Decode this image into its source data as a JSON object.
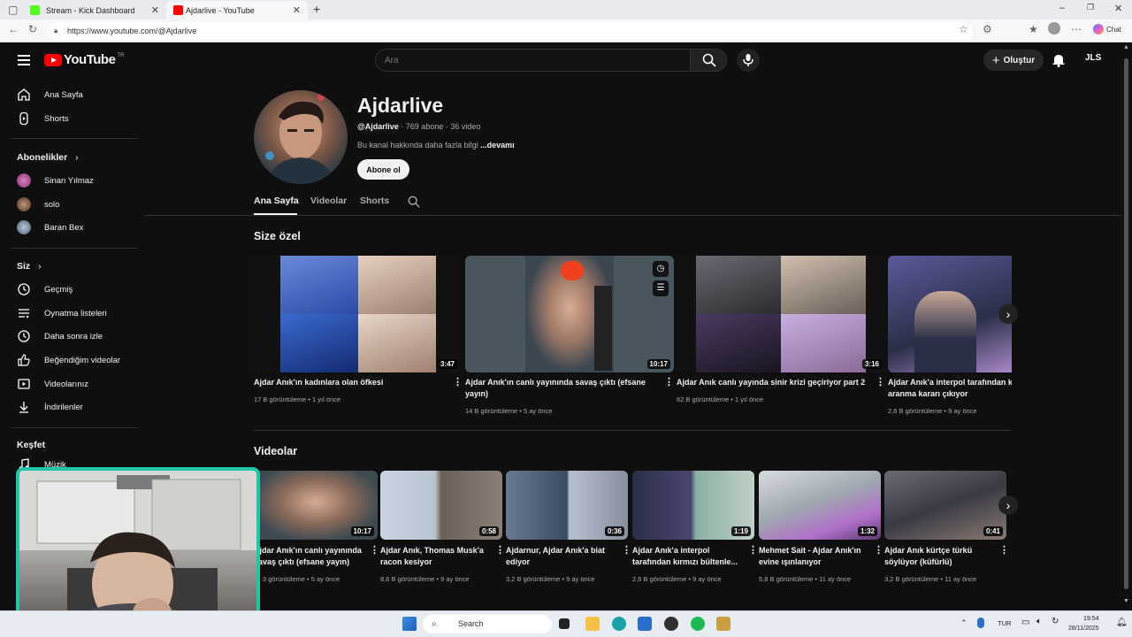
{
  "browser": {
    "tabs": [
      {
        "title": "Stream - Kick Dashboard",
        "favicon_color": "#53fc18"
      },
      {
        "title": "Ajdarlive - YouTube",
        "favicon_color": "#ff0000"
      }
    ],
    "url": "https://www.youtube.com/@Ajdarlive",
    "copilot_label": "Chat"
  },
  "masthead": {
    "logo_text": "YouTube",
    "logo_suffix": "TR",
    "search_placeholder": "Ara",
    "create_label": "Oluştur",
    "account_initials": "JLS"
  },
  "sidebar": {
    "main": [
      {
        "label": "Ana Sayfa",
        "icon": "home-icon"
      },
      {
        "label": "Shorts",
        "icon": "shorts-icon"
      }
    ],
    "subscriptions_title": "Abonelikler",
    "subscriptions": [
      {
        "label": "Sinan Yılmaz",
        "color": "#b84c9a"
      },
      {
        "label": "solo",
        "color": "#7a5a3a"
      },
      {
        "label": "Baran Bex",
        "color": "#5a6e84"
      }
    ],
    "you_title": "Siz",
    "you_items": [
      {
        "label": "Geçmiş",
        "icon": "history-icon"
      },
      {
        "label": "Oynatma listeleri",
        "icon": "playlist-icon"
      },
      {
        "label": "Daha sonra izle",
        "icon": "clock-icon"
      },
      {
        "label": "Beğendiğim videolar",
        "icon": "thumbs-up-icon"
      },
      {
        "label": "Videolarınız",
        "icon": "your-videos-icon"
      },
      {
        "label": "İndirilenler",
        "icon": "download-icon"
      }
    ],
    "explore_title": "Keşfet",
    "explore_items": [
      {
        "label": "Müzik",
        "icon": "music-icon"
      }
    ]
  },
  "channel": {
    "name": "Ajdarlive",
    "handle": "@Ajdarlive",
    "stats": " · 769 abone · 36 video",
    "description": "Bu kanal hakkında daha fazla bilgi",
    "more_label": "...devamı",
    "subscribe_label": "Abone ol",
    "tabs": [
      "Ana Sayfa",
      "Videolar",
      "Shorts"
    ]
  },
  "for_you": {
    "title": "Size özel",
    "videos": [
      {
        "title_line1": "Ajdar Anık'ın kadınlara olan öfkesi",
        "title_line2": "",
        "meta": "17 B görüntüleme • 1 yıl önce",
        "duration": "3:47",
        "colors": [
          "#3a5fb0",
          "#c9a38c",
          "#1d3d8a",
          "#d4b0a0"
        ]
      },
      {
        "title_line1": "Ajdar Anık'ın canlı yayınında savaş çıktı (efsane",
        "title_line2": "yayın)",
        "meta": "14 B görüntüleme • 5 ay önce",
        "duration": "10:17",
        "colors": [
          "#3d4a52",
          "#caa08a",
          "#44505a",
          "#5a6570"
        ]
      },
      {
        "title_line1": "Ajdar Anık canlı yayında sinir krizi geçiriyor part 2",
        "title_line2": "",
        "meta": "62 B görüntüleme • 1 yıl önce",
        "duration": "3:16",
        "colors": [
          "#55555c",
          "#b09a8e",
          "#6a5878",
          "#c4a898"
        ]
      },
      {
        "title_line1": "Ajdar Anık'a interpol tarafından kı",
        "title_line2": "aranma kararı çıkıyor",
        "meta": "2,6 B görüntüleme • 9 ay önce",
        "duration": "",
        "colors": [
          "#2a2f48",
          "#6a6aa8",
          "#3a3560",
          "#a88ec0"
        ]
      }
    ]
  },
  "videos_section": {
    "title": "Videolar",
    "videos": [
      {
        "title_line1": "Ajdar Anık'ın canlı yayınında",
        "title_line2": "savaş çıktı (efsane yayın)",
        "meta": "3 görüntüleme • 5 ay önce",
        "duration": "10:17",
        "colors": [
          "#3d4a52",
          "#caa08a"
        ]
      },
      {
        "title_line1": "Ajdar Anık, Thomas Musk'a",
        "title_line2": "racon kesiyor",
        "meta": "8,6 B görüntüleme • 9 ay önce",
        "duration": "0:58",
        "colors": [
          "#b8c4d0",
          "#8a8078"
        ]
      },
      {
        "title_line1": "Ajdarnur, Ajdar Anık'a biat",
        "title_line2": "ediyor",
        "meta": "3,2 B görüntüleme • 9 ay önce",
        "duration": "0:36",
        "colors": [
          "#5a6a80",
          "#a8b0c0"
        ]
      },
      {
        "title_line1": "Ajdar Anık'a interpol",
        "title_line2": "tarafından kırmızı bültenle...",
        "meta": "2,6 B görüntüleme • 9 ay önce",
        "duration": "1:19",
        "colors": [
          "#3a3560",
          "#8ab0a0"
        ]
      },
      {
        "title_line1": "Mehmet Sait - Ajdar Anık'ın",
        "title_line2": "evine ışınlanıyor",
        "meta": "5,8 B görüntüleme • 11 ay önce",
        "duration": "1:32",
        "colors": [
          "#c0c8d0",
          "#b070c8"
        ]
      },
      {
        "title_line1": "Ajdar Anık kürtçe türkü",
        "title_line2": "söylüyor (küfürlü)",
        "meta": "3,2 B görüntüleme • 11 ay önce",
        "duration": "0:41",
        "colors": [
          "#4a4a55",
          "#8a7a70"
        ]
      }
    ]
  },
  "taskbar": {
    "search_label": "Search",
    "language": "TUR",
    "time": "19:54",
    "date": "28/11/2025"
  }
}
